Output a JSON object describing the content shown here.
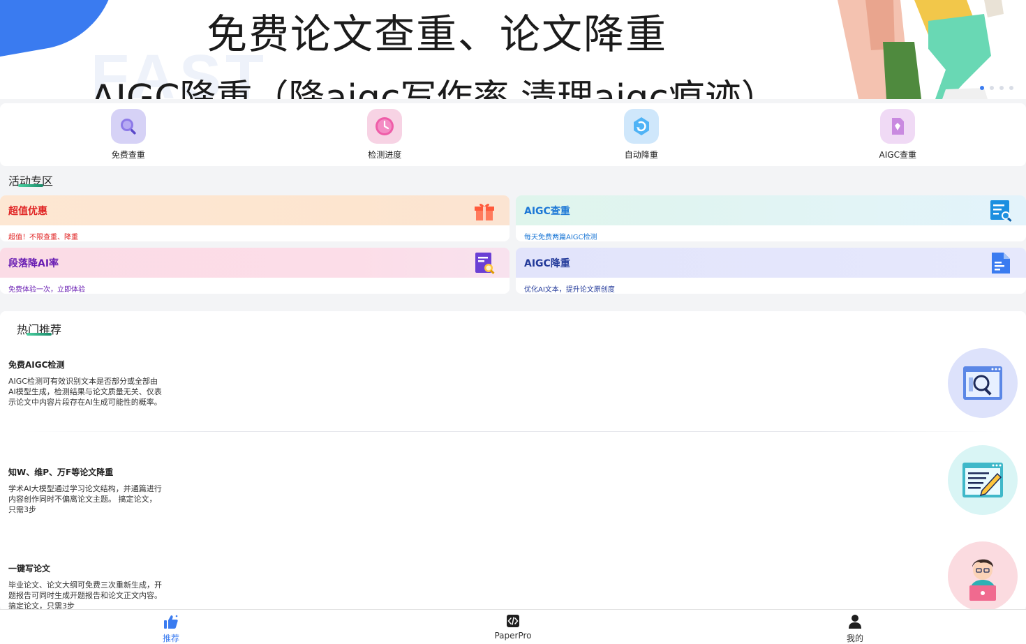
{
  "banner": {
    "title": "免费论文查重、论文降重",
    "subtitle": "AIGC降重（降aigc写作率   清理aigc痕迹）",
    "ghost": "FAST",
    "active_index": 0
  },
  "quick": [
    {
      "label": "免费查重",
      "icon": "search-icon"
    },
    {
      "label": "检测进度",
      "icon": "clock-icon"
    },
    {
      "label": "自动降重",
      "icon": "refresh-icon"
    },
    {
      "label": "AIGC查重",
      "icon": "diamond-doc-icon"
    }
  ],
  "activity": {
    "title": "活动专区",
    "cards": [
      {
        "title": "超值优惠",
        "desc": "超值！不限查重、降重",
        "title_color": "#e02424",
        "desc_color": "#e02424",
        "icon": "gift-icon"
      },
      {
        "title": "AIGC查重",
        "desc": "每天免费两篇AIGC检测",
        "title_color": "#1d78d6",
        "desc_color": "#1d78d6",
        "icon": "doc-search-icon"
      },
      {
        "title": "段落降AI率",
        "desc": "免费体验一次，立即体验",
        "title_color": "#6a1fb3",
        "desc_color": "#6a1fb3",
        "icon": "doc-magnify-icon"
      },
      {
        "title": "AIGC降重",
        "desc": "优化AI文本，提升论文原创度",
        "title_color": "#233a9a",
        "desc_color": "#233a9a",
        "icon": "document-icon"
      }
    ]
  },
  "hot": {
    "title": "热门推荐",
    "items": [
      {
        "title": "免费AIGC检测",
        "desc": "AIGC检测可有效识别文本是否部分或全部由AI模型生成，检测结果与论文质量无关、仅表示论文中内容片段存在AI生成可能性的概率。",
        "icon": "browser-search-icon"
      },
      {
        "title": "知W、维P、万F等论文降重",
        "desc": "学术AI大模型通过学习论文结构，并通篇进行内容创作同时不偏离论文主题。 搞定论文，只需3步",
        "icon": "edit-window-icon"
      },
      {
        "title": "一键写论文",
        "desc": "毕业论文、论文大纲可免费三次重新生成，开题报告可同时生成开题报告和论文正文内容。 搞定论文，只需3步",
        "icon": "writer-avatar-icon"
      }
    ]
  },
  "tabs": [
    {
      "label": "推荐",
      "icon": "thumbs-up-icon",
      "active": true
    },
    {
      "label": "PaperPro",
      "icon": "code-icon",
      "active": false
    },
    {
      "label": "我的",
      "icon": "user-icon",
      "active": false
    }
  ],
  "colors": {
    "brand": "#3a7bf0"
  }
}
